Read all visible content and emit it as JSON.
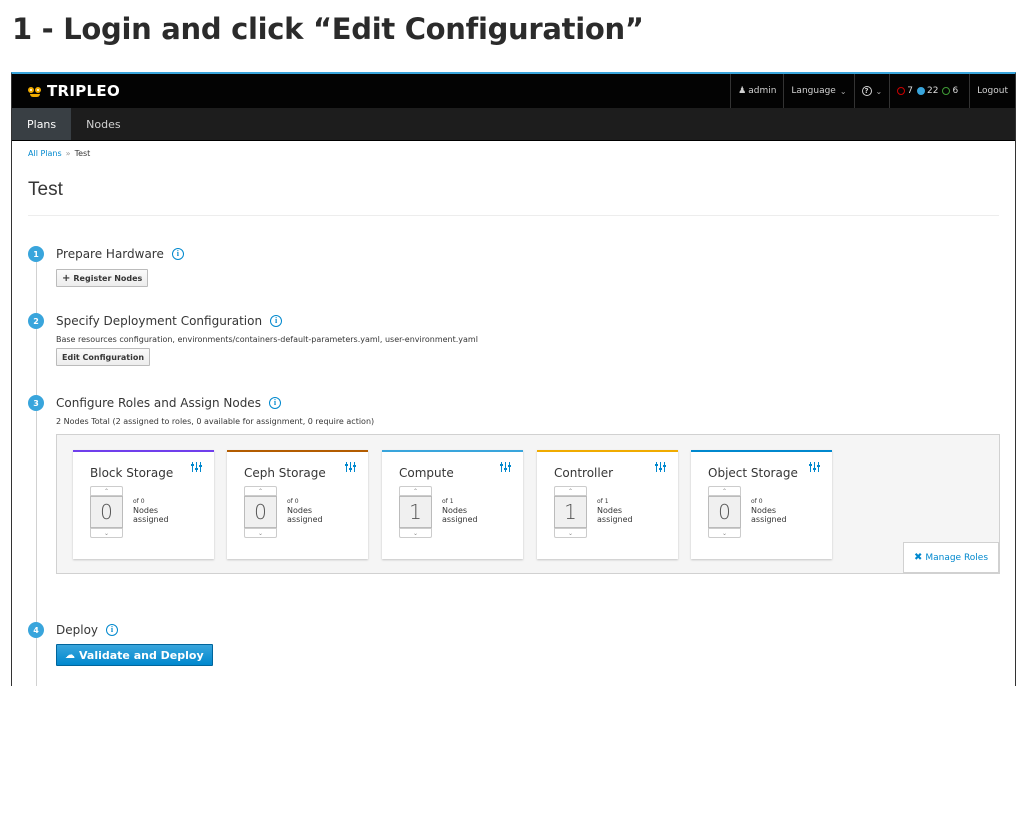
{
  "caption": "1 - Login and click “Edit Configuration”",
  "app": {
    "brand": "TRIPLEO"
  },
  "topbar": {
    "user": "admin",
    "language": "Language",
    "help": "?",
    "notifications": {
      "errors": "7",
      "running": "22",
      "success": "6"
    },
    "logout": "Logout"
  },
  "nav": {
    "tabs": [
      "Plans",
      "Nodes"
    ]
  },
  "breadcrumb": {
    "root": "All Plans",
    "sep": "»",
    "current": "Test"
  },
  "page_title": "Test",
  "steps": [
    {
      "num": "1",
      "title": "Prepare Hardware",
      "button": "Register Nodes"
    },
    {
      "num": "2",
      "title": "Specify Deployment Configuration",
      "desc": "Base resources configuration, environments/containers-default-parameters.yaml, user-environment.yaml",
      "button": "Edit Configuration"
    },
    {
      "num": "3",
      "title": "Configure Roles and Assign Nodes",
      "desc": "2 Nodes Total (2 assigned to roles, 0 available for assignment, 0 require action)"
    },
    {
      "num": "4",
      "title": "Deploy",
      "button": "Validate and Deploy"
    }
  ],
  "roles": [
    {
      "name": "Block Storage",
      "count": "0",
      "of": "of 0",
      "label1": "Nodes",
      "label2": "assigned",
      "color": "#703fec"
    },
    {
      "name": "Ceph Storage",
      "count": "0",
      "of": "of 0",
      "label1": "Nodes",
      "label2": "assigned",
      "color": "#b35c00"
    },
    {
      "name": "Compute",
      "count": "1",
      "of": "of 1",
      "label1": "Nodes",
      "label2": "assigned",
      "color": "#39a5dc"
    },
    {
      "name": "Controller",
      "count": "1",
      "of": "of 1",
      "label1": "Nodes",
      "label2": "assigned",
      "color": "#f0ab00"
    },
    {
      "name": "Object Storage",
      "count": "0",
      "of": "of 0",
      "label1": "Nodes",
      "label2": "assigned",
      "color": "#0088ce"
    }
  ],
  "manage_roles": "Manage Roles",
  "colors": {
    "accent": "#0088ce",
    "primary_button": "#39a5dc",
    "step_badge": "#39a5dc"
  }
}
